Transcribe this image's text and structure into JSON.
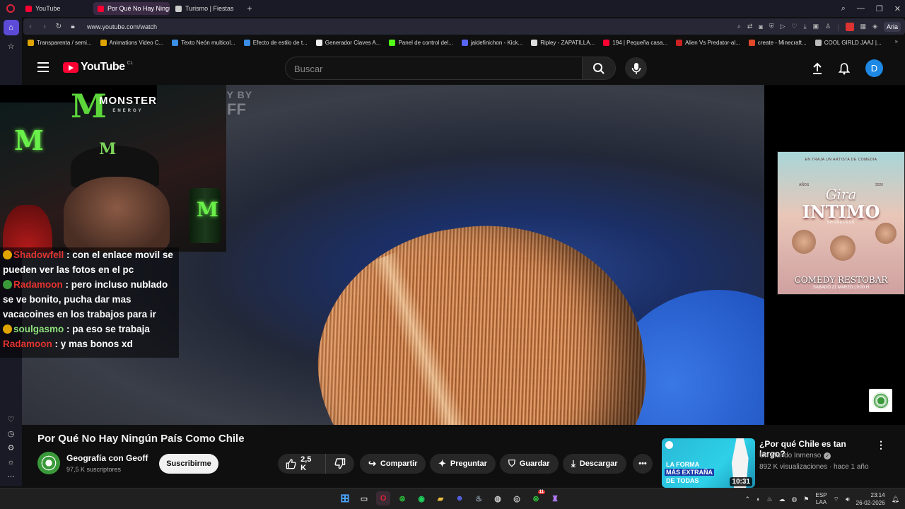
{
  "browser": {
    "tabs": [
      {
        "label": "YouTube",
        "color": "#ff0033",
        "active": false
      },
      {
        "label": "Por Qué No Hay Ningún",
        "color": "#ff0033",
        "active": true
      },
      {
        "label": "Turismo | Fiestas",
        "color": "#cccccc",
        "active": false
      }
    ],
    "url": "www.youtube.com/watch",
    "ai_label": "Aria",
    "bookmarks": [
      {
        "label": "Transparenta / semi...",
        "color": "#e0a400"
      },
      {
        "label": "Animations Video C...",
        "color": "#e0a400"
      },
      {
        "label": "Texto Neón multicol...",
        "color": "#3a8ee6"
      },
      {
        "label": "Efecto de estilo de t...",
        "color": "#3a8ee6"
      },
      {
        "label": "Generador Claves A...",
        "color": "#eeeeee"
      },
      {
        "label": "Panel de control del...",
        "color": "#53fc18"
      },
      {
        "label": "jaidefinichon - Kick...",
        "color": "#5865f2"
      },
      {
        "label": "Ripley - ZAPATILLA...",
        "color": "#dddddd"
      },
      {
        "label": "194 | Pequeña casa...",
        "color": "#ff0033"
      },
      {
        "label": "Alien Vs Predator-al...",
        "color": "#cc2222"
      },
      {
        "label": "create - Minecraft...",
        "color": "#e04a2a"
      },
      {
        "label": "COOL GIRLD JAAJ |...",
        "color": "#bbbbbb"
      }
    ]
  },
  "header": {
    "logo_text": "YouTube",
    "country": "CL",
    "search_placeholder": "Buscar",
    "avatar_letter": "D"
  },
  "video": {
    "watermark_top": "GEOGRAPHY BY",
    "watermark_bottom": "FF"
  },
  "overlay": {
    "monster_word": "MONSTER",
    "monster_sub": "ENERGY",
    "chat": [
      {
        "user": "Shadowfell",
        "text": ": con el enlace movil se pueden ver las fotos en el pc",
        "badge": "gold",
        "color": "red"
      },
      {
        "user": "Radamoon",
        "text": ": pero incluso nublado se ve bonito, pucha dar mas vacacoines en los trabajos para ir",
        "badge": "green",
        "color": "red"
      },
      {
        "user": "soulgasmo",
        "text": ": pa eso se trabaja",
        "badge": "gold",
        "color": "green"
      },
      {
        "user": "Radamoon",
        "text": ": y mas bonos xd",
        "badge": "",
        "color": "red"
      }
    ]
  },
  "ad": {
    "top_line": "EN TRAJA UN ARTISTA DE COMEDIA",
    "year_left": "AÑOS",
    "year_right": "2026",
    "gira": "Gira",
    "intimo": "INTIMO",
    "shore": "SHORELESS",
    "venue": "COMEDY RESTOBAR",
    "date": "SABADO 21 MARZO | 9:00 H"
  },
  "main": {
    "title": "Por Qué No Hay Ningún País Como Chile",
    "channel_name": "Geografía con Geoff",
    "subscribers": "97,5 K suscriptores",
    "subscribe_label": "Suscribirme",
    "likes": "2,5 K",
    "share_label": "Compartir",
    "ask_label": "Preguntar",
    "save_label": "Guardar",
    "download_label": "Descargar"
  },
  "recommendation": {
    "title": "¿Por qué Chile es tan largo?",
    "channel": "Un Mundo Inmenso",
    "meta": "892 K visualizaciones · hace 1 año",
    "duration": "10:31",
    "thumb_line1": "LA FORMA",
    "thumb_line2": "MÁS EXTRAÑA",
    "thumb_line3": "DE TODAS"
  },
  "taskbar": {
    "lang": "ESP",
    "lang2": "LAA",
    "time": "23:14",
    "date": "26-02-2026",
    "badge_count": "11"
  }
}
